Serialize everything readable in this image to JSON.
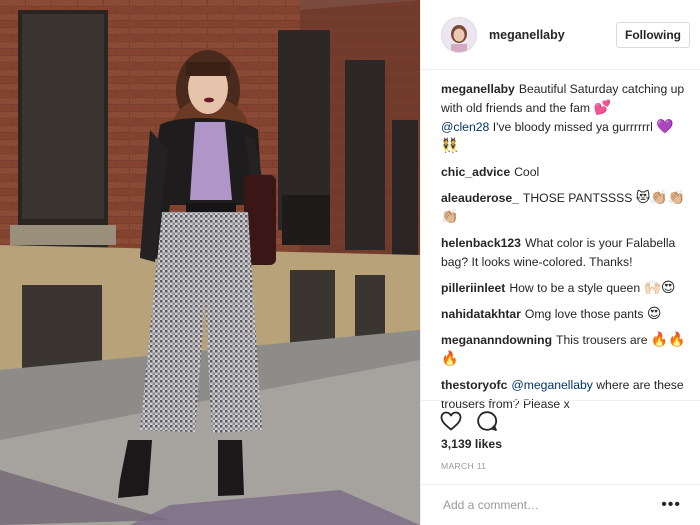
{
  "post": {
    "username": "meganellaby",
    "follow_label": "Following",
    "caption": {
      "user": "meganellaby",
      "text1": "Beautiful Saturday catching up with old friends and the fam",
      "emoji1": "💕",
      "mention": "@clen28",
      "text2": "I've bloody missed ya gurrrrrrl",
      "emoji2": "💜",
      "emoji3": "👯"
    },
    "comments": [
      {
        "user": "chic_advice",
        "text": "Cool",
        "emoji": ""
      },
      {
        "user": "aleauderose_",
        "text": "THOSE PANTSSSS",
        "emoji": "😻👏🏼👏🏼👏🏼"
      },
      {
        "user": "helenback123",
        "text": "What color is your Falabella bag? It looks wine-colored. Thanks!",
        "emoji": ""
      },
      {
        "user": "pilleriinleet",
        "text": "How to be a style queen",
        "emoji": "🙌🏻😍"
      },
      {
        "user": "nahidatakhtar",
        "text": "Omg love those pants",
        "emoji": "😍"
      },
      {
        "user": "megananndowning",
        "text": "This trousers are",
        "emoji": "🔥🔥🔥"
      },
      {
        "user": "thestoryofc",
        "mention": "@meganellaby",
        "text": "where are these trousers from? Please x",
        "emoji": ""
      }
    ],
    "likes": "3,139 likes",
    "date": "MARCH 11",
    "add_comment_placeholder": "Add a comment…",
    "more_label": "•••",
    "icons": {
      "like": "heart-icon",
      "comment": "comment-icon",
      "more": "more-options-icon"
    },
    "colors": {
      "link": "#003569",
      "muted": "#999999",
      "border": "#efefef"
    }
  }
}
